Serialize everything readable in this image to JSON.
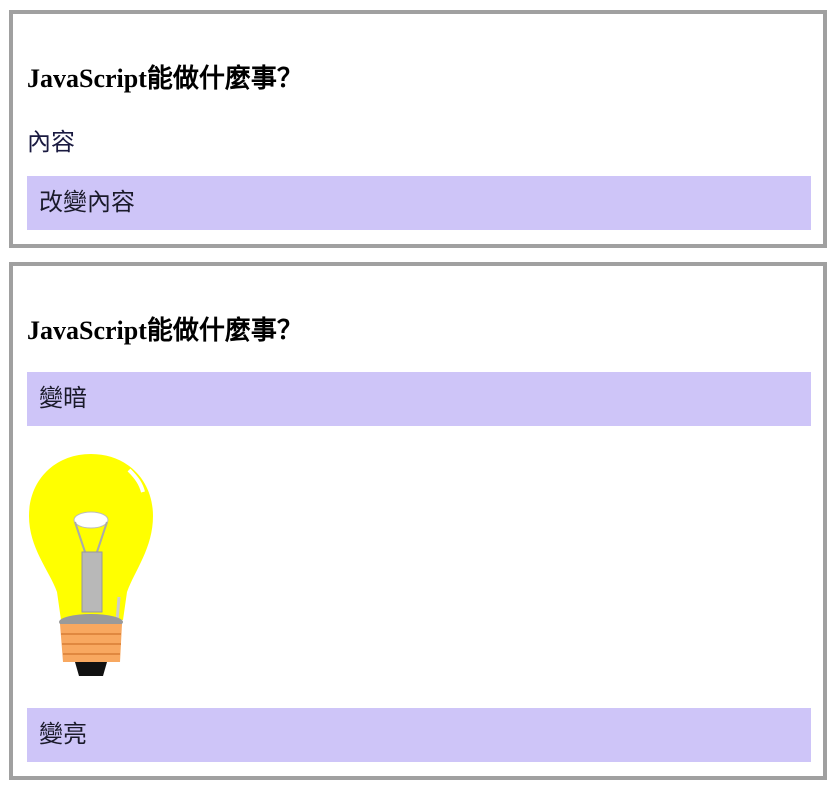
{
  "section1": {
    "heading": "JavaScript能做什麼事？",
    "content": "內容",
    "change_button": "改變內容"
  },
  "section2": {
    "heading": "JavaScript能做什麼事？",
    "dim_button": "變暗",
    "bulb_state": "on",
    "bright_button": "變亮"
  },
  "colors": {
    "button_bg": "#cec5f8",
    "border": "#a0a0a0",
    "bulb": "#ffff00"
  }
}
